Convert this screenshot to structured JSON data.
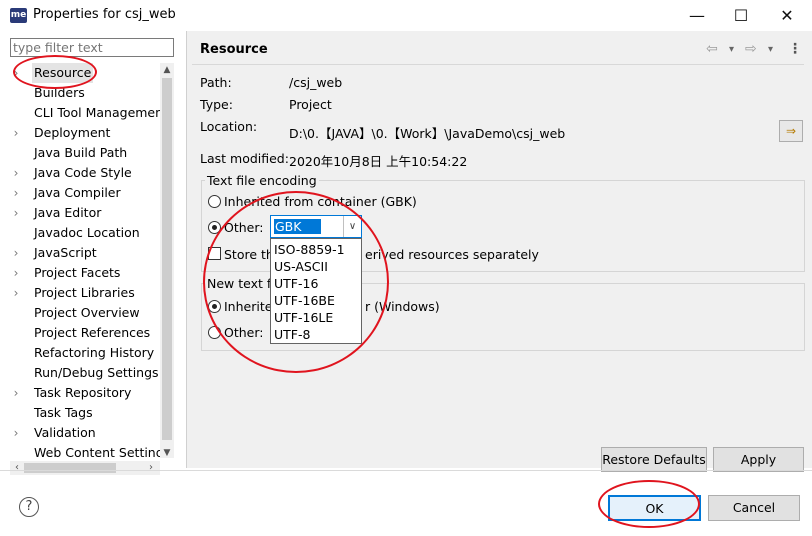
{
  "window": {
    "app_icon_text": "me",
    "title": "Properties for csj_web",
    "minimize": "—",
    "maximize": "☐",
    "close": "✕"
  },
  "filter": {
    "placeholder": "type filter text"
  },
  "tree": {
    "items": [
      {
        "label": "Resource",
        "arrow": "›",
        "selected": true
      },
      {
        "label": "Builders",
        "arrow": ""
      },
      {
        "label": "CLI Tool Managemen",
        "arrow": ""
      },
      {
        "label": "Deployment",
        "arrow": "›"
      },
      {
        "label": "Java Build Path",
        "arrow": ""
      },
      {
        "label": "Java Code Style",
        "arrow": "›"
      },
      {
        "label": "Java Compiler",
        "arrow": "›"
      },
      {
        "label": "Java Editor",
        "arrow": "›"
      },
      {
        "label": "Javadoc Location",
        "arrow": ""
      },
      {
        "label": "JavaScript",
        "arrow": "›"
      },
      {
        "label": "Project Facets",
        "arrow": "›"
      },
      {
        "label": "Project Libraries",
        "arrow": "›"
      },
      {
        "label": "Project Overview",
        "arrow": ""
      },
      {
        "label": "Project References",
        "arrow": ""
      },
      {
        "label": "Refactoring History",
        "arrow": ""
      },
      {
        "label": "Run/Debug Settings",
        "arrow": ""
      },
      {
        "label": "Task Repository",
        "arrow": "›"
      },
      {
        "label": "Task Tags",
        "arrow": ""
      },
      {
        "label": "Validation",
        "arrow": "›"
      },
      {
        "label": "Web Content Settings",
        "arrow": ""
      }
    ]
  },
  "page": {
    "title": "Resource",
    "nav": {
      "back": "⇦",
      "back_menu": "▾",
      "forward": "⇨",
      "forward_menu": "▾",
      "view_menu": "⋮"
    },
    "path_label": "Path:",
    "path_value": "/csj_web",
    "type_label": "Type:",
    "type_value": "Project",
    "location_label": "Location:",
    "location_value": "D:\\0.【JAVA】\\0.【Work】\\JavaDemo\\csj_web",
    "location_button_icon": "⇒",
    "modified_label": "Last modified:",
    "modified_value": "2020年10月8日 上午10:54:22"
  },
  "encoding": {
    "group_title": "Text file encoding",
    "inherited_label": "Inherited from container (GBK)",
    "other_label": "Other:",
    "selected": "GBK",
    "store_label_start": "Store th",
    "store_label_end": "erived resources separately",
    "options": [
      "ISO-8859-1",
      "US-ASCII",
      "UTF-16",
      "UTF-16BE",
      "UTF-16LE",
      "UTF-8"
    ]
  },
  "line_delimiter": {
    "group_title_partial": "New text fi",
    "inherited_start": "Inherite",
    "inherited_end": "r (Windows)",
    "other_label": "Other:"
  },
  "buttons": {
    "restore_defaults": "Restore Defaults",
    "apply": "Apply",
    "ok": "OK",
    "cancel": "Cancel",
    "help": "?"
  },
  "colors": {
    "highlight": "#0078d7",
    "annotation_red": "#e0141e",
    "panel_bg": "#f0f0f0"
  }
}
